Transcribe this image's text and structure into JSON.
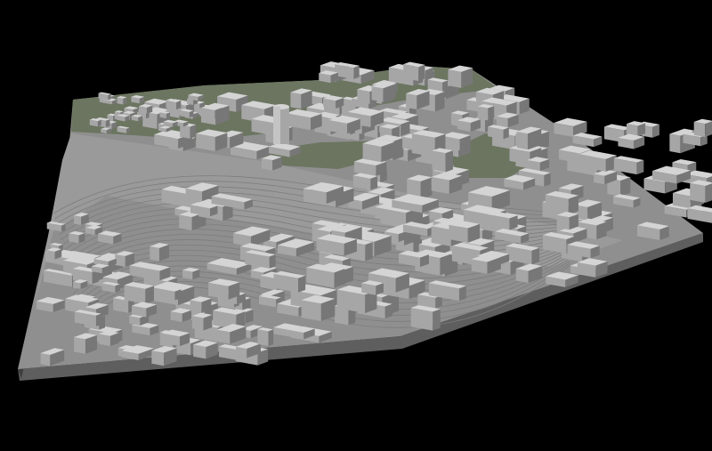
{
  "scene": {
    "background_color": "#000000",
    "ground_color": "#8f8f8f",
    "base_side_color": "#5e5e5e",
    "grass_color": "#6b7560",
    "rail_yard_color": "#9a9a9a",
    "rail_line_color": "#7d7d7d",
    "building_top_color": "#d4d4d4",
    "building_side_color": "#a6a6a6",
    "building_dark_side_color": "#777777"
  }
}
